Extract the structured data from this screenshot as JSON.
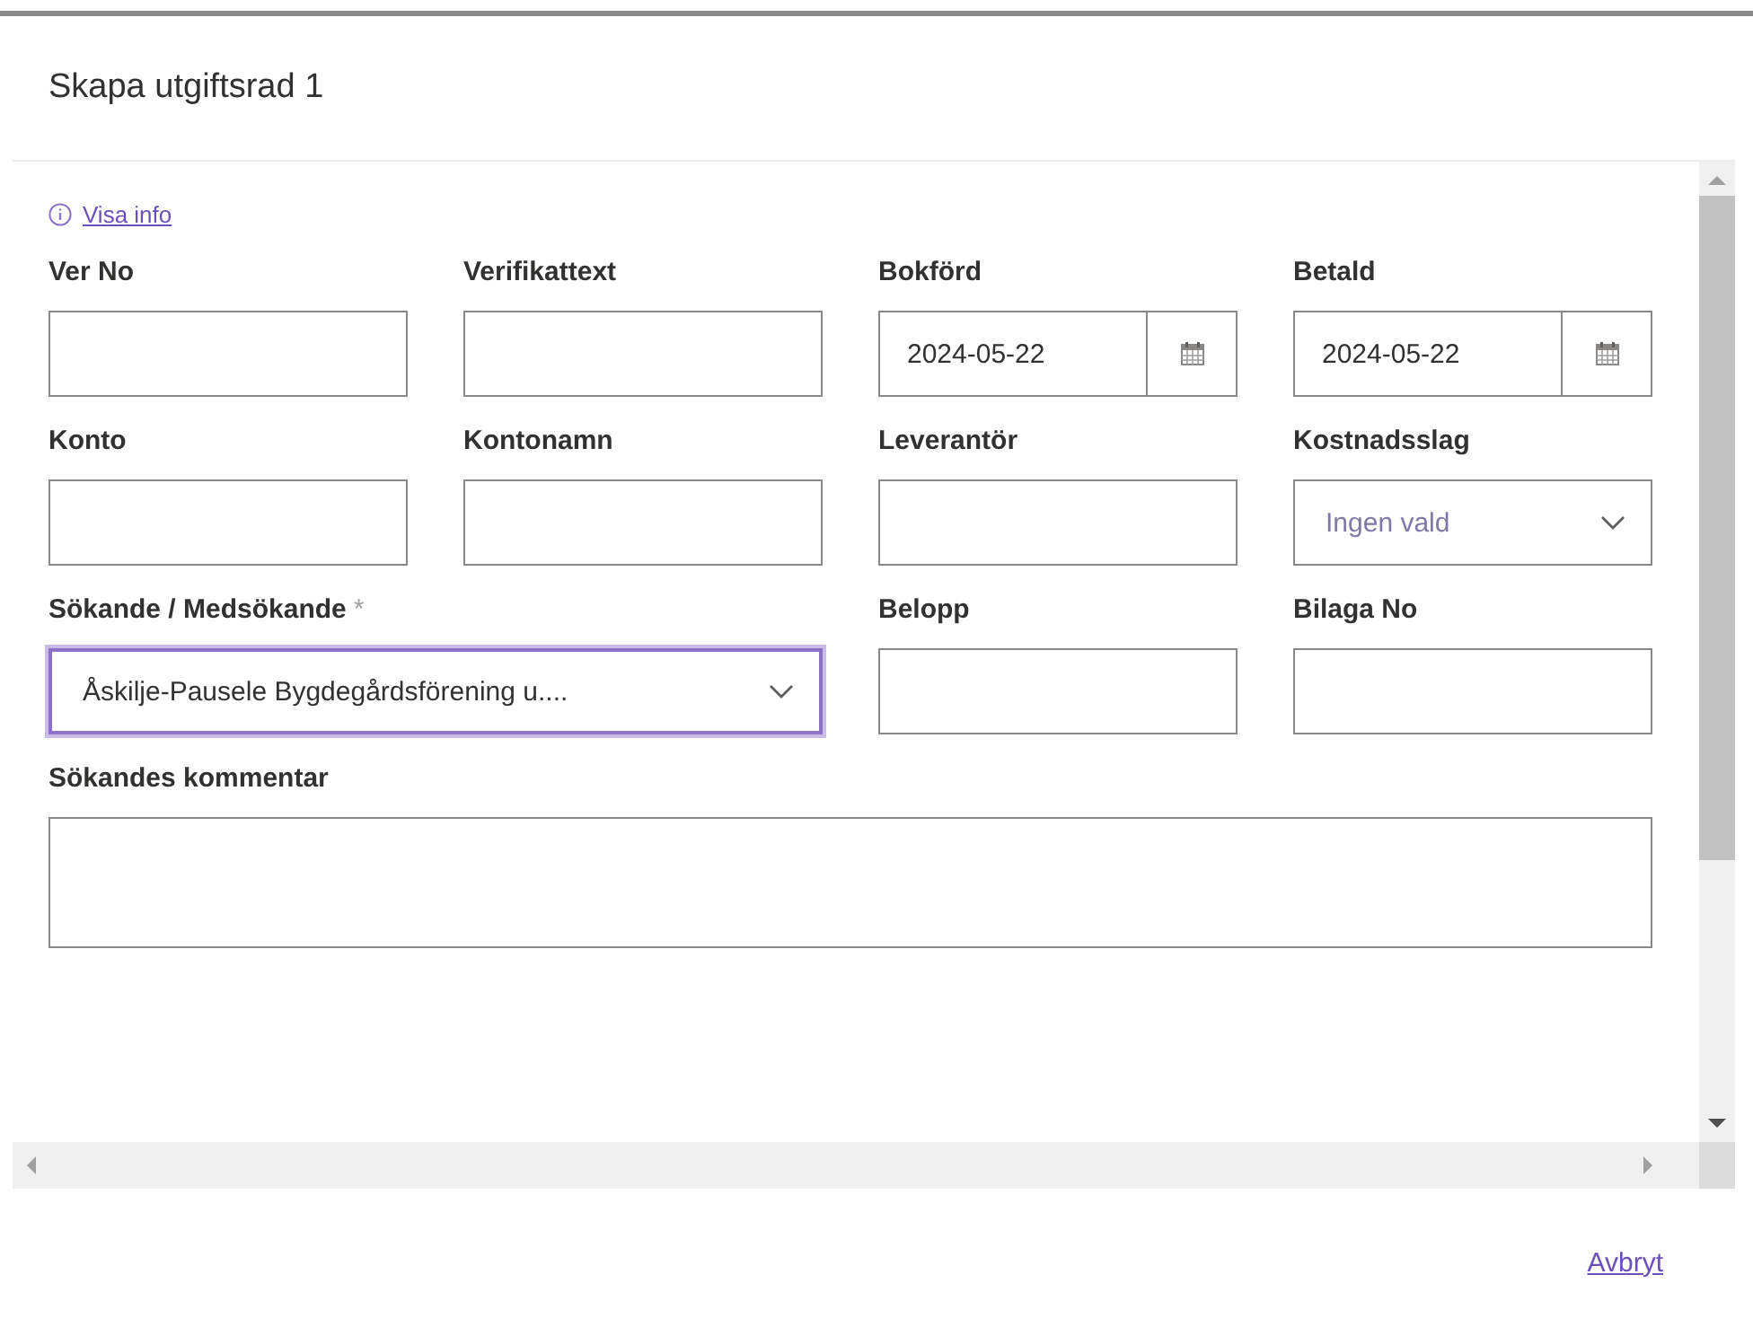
{
  "dialog": {
    "title": "Skapa utgiftsrad 1"
  },
  "info_link": {
    "label": "Visa info"
  },
  "fields": [
    {
      "kind": "text",
      "label": "Ver No"
    },
    {
      "kind": "text",
      "label": "Verifikattext"
    },
    {
      "kind": "date",
      "label": "Bokförd",
      "value": "2024-05-22"
    },
    {
      "kind": "date",
      "label": "Betald",
      "value": "2024-05-22"
    },
    {
      "kind": "text",
      "label": "Konto"
    },
    {
      "kind": "text",
      "label": "Kontonamn"
    },
    {
      "kind": "text",
      "label": "Leverantör"
    },
    {
      "kind": "select",
      "label": "Kostnadsslag",
      "placeholder": "Ingen vald",
      "focused": false
    },
    {
      "kind": "wideselect",
      "label": "Sökande / Medsökande",
      "marker": "*",
      "value": "Åskilje-Pausele Bygdegårdsförening u....",
      "focused": true
    },
    {
      "kind": "text",
      "label": "Belopp"
    },
    {
      "kind": "text",
      "label": "Bilaga No"
    },
    {
      "kind": "textarea",
      "label": "Sökandes kommentar"
    }
  ],
  "footer": {
    "cancel_link": "Avbryt"
  }
}
